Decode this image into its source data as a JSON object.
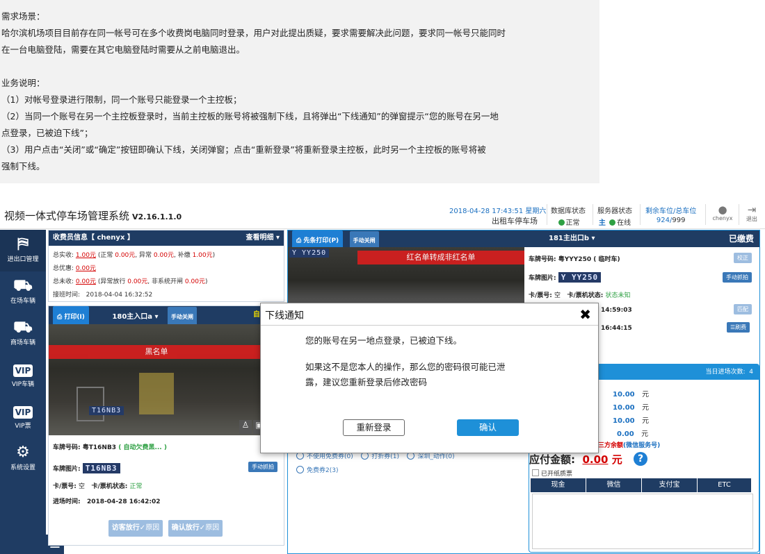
{
  "requirement": {
    "heading": "需求场景：",
    "scene_line1": "哈尔滨机场项目目前存在同一帐号可在多个收费岗电脑同时登录，用户对此提出质疑，要求需要解决此问题，要求同一帐号只能同时",
    "scene_line2": "在一台电脑登陆，需要在其它电脑登陆时需要从之前电脑退出。",
    "biz_heading": "业务说明：",
    "item1": "（1）对帐号登录进行限制，同一个账号只能登录一个主控板；",
    "item2_line1": "（2）当同一个账号在另一个主控板登录时，当前主控板的账号将被强制下线，且将弹出“下线通知”的弹窗提示“您的账号在另一地",
    "item2_line2": "点登录，已被迫下线”；",
    "item3_line1": "（3）用户点击“关闭”或“确定”按钮即确认下线，关闭弹窗；点击“重新登录”将重新登录主控板，此时另一个主控板的账号将被",
    "item3_line2": "强制下线。"
  },
  "header": {
    "app_title": "视频一体式停车场管理系统",
    "version": "V2.16.1.1.0",
    "datetime": "2018-04-28 17:43:51 星期六",
    "location": "出租车停车场",
    "db_status_label": "数据库状态",
    "db_status_value": "正常",
    "server_status_label": "服务器状态",
    "server_main": "主",
    "server_status_value": "在线",
    "spaces_label": "剩余车位/总车位",
    "spaces_remaining": "924",
    "spaces_sep": "/",
    "spaces_total": "999",
    "user": "chenyx",
    "logout": "退出"
  },
  "sidebar": {
    "items": [
      {
        "label": "进出口管理",
        "icon": "gate-icon"
      },
      {
        "label": "在场车辆",
        "icon": "car-icon"
      },
      {
        "label": "商场车辆",
        "icon": "car-icon"
      },
      {
        "label": "VIP车辆",
        "icon": "vip-icon",
        "badge": "VIP"
      },
      {
        "label": "VIP票",
        "icon": "vip-icon",
        "badge": "VIP"
      },
      {
        "label": "系统设置",
        "icon": "gear-icon"
      }
    ],
    "menu_glyph": "☰"
  },
  "collector": {
    "title": "收费员信息【 chenyx 】",
    "details": "查看明细",
    "total_received_label": "总实收:",
    "total_received": "1.00元",
    "total_breakdown_pre": "(正常",
    "normal": "0.00元",
    "abnormal_label": "异常",
    "abnormal": "0.00元",
    "supplement_label": "补缴",
    "supplement": "1.00元",
    "close_paren": ")",
    "discount_label": "总优惠:",
    "discount": "0.00元",
    "uncollected_label": "总未收:",
    "uncollected": "0.00元",
    "uncollected_pre": "(异常放行",
    "abn_release": "0.00元",
    "non_system_label": "非系统开闸",
    "non_system": "0.00元",
    "shift_label": "接班时间:",
    "shift_time": "2018-04-04 16:32:52"
  },
  "entry_lane": {
    "print": "打印(I)",
    "lane_name": "180主入口a",
    "manual_close": "手动关闸",
    "status": "自动欠费",
    "banner": "黑名单",
    "plate_label": "车牌号码:",
    "plate_value": "粤T16NB3",
    "plate_note": "( 自动欠费黑... )",
    "image_label": "车牌图片:",
    "plate_image_text": "T16NB3",
    "manual_capture": "手动抓拍",
    "card_label": "卡/票号:",
    "card_value": "空",
    "card_status_label": "卡/票机状态:",
    "card_status": "正常",
    "time_label": "进场时间:",
    "time_value": "2018-04-28 16:42:02",
    "btn_visitor": "访客放行",
    "btn_confirm": "确认放行",
    "reason": "原因"
  },
  "exit_lane": {
    "print": "先条打印(P)",
    "manual_close": "手动关闸",
    "lane_name": "181主出口b",
    "status": "已缴费",
    "banner": "红名单转成非红名单",
    "plate_label": "车牌号码:",
    "plate_value": "粤YYY250 ( 临时车)",
    "correct": "校正",
    "image_label": "车牌图片:",
    "plate_image_text": "Y YY250",
    "manual_capture": "手动抓拍",
    "card_label": "卡/票号:",
    "card_value": "空",
    "card_status_label": "卡/票机状态:",
    "card_status": "状态未知",
    "time1": "14:59:03",
    "match": "匹配",
    "time2": "16:44:15",
    "refresh": "刷费"
  },
  "payment": {
    "today_label": "当日进场次数:",
    "today_count": "4",
    "amount1": "10.00",
    "amount2": "10.00",
    "amount3": "10.00",
    "amount4": "0.00",
    "unit": "元",
    "third_party": "第三方余额",
    "third_party_note": "(微信服务号)",
    "due_label": "应付金额:",
    "due_value": "0.00",
    "due_unit": "元",
    "help": "?",
    "invoice": "已开纸质票",
    "tabs": [
      "现金",
      "微信",
      "支付宝",
      "ETC"
    ]
  },
  "coupons": {
    "row1a": "不使用免费券(0)",
    "row1b": "打折券(1)",
    "row1c": "深圳_动作(0)",
    "row2": "免费券2(3)"
  },
  "dialog": {
    "title": "下线通知",
    "close": "✖",
    "message1": "您的账号在另一地点登录，已被迫下线。",
    "message2_line1": "如果这不是您本人的操作，那么您的密码很可能已泄",
    "message2_line2": "露，建议您重新登录后修改密码",
    "relogin": "重新登录",
    "confirm": "确认"
  },
  "colors": {
    "navy": "#1f3c63",
    "accent_blue": "#1e90d8",
    "alert_red": "#d21f1f"
  }
}
